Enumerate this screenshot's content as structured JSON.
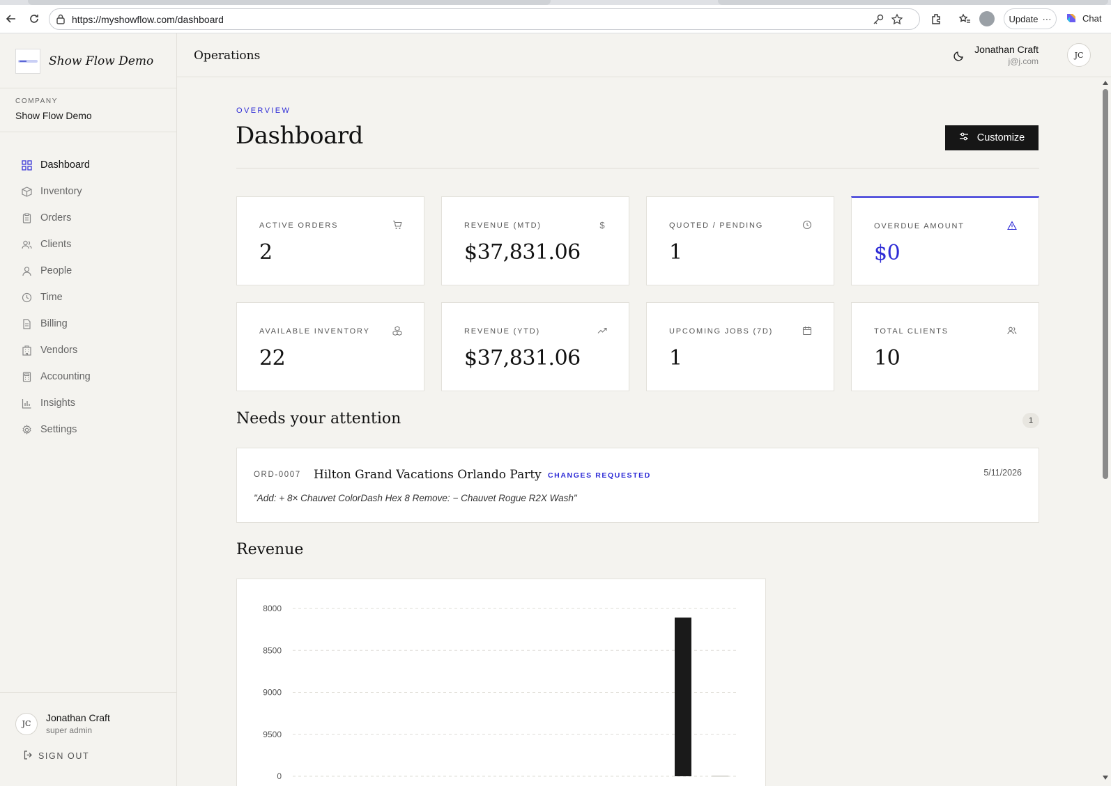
{
  "browser": {
    "url": "https://myshowflow.com/dashboard",
    "update_label": "Update",
    "chat_label": "Chat"
  },
  "sidebar": {
    "brand_name": "Show Flow Demo",
    "company_label": "COMPANY",
    "company_name": "Show Flow Demo",
    "items": [
      {
        "label": "Dashboard",
        "icon": "grid-icon",
        "active": true
      },
      {
        "label": "Inventory",
        "icon": "box-icon"
      },
      {
        "label": "Orders",
        "icon": "clipboard-icon"
      },
      {
        "label": "Clients",
        "icon": "users-icon"
      },
      {
        "label": "People",
        "icon": "user-icon"
      },
      {
        "label": "Time",
        "icon": "clock-icon"
      },
      {
        "label": "Billing",
        "icon": "file-icon"
      },
      {
        "label": "Vendors",
        "icon": "building-icon"
      },
      {
        "label": "Accounting",
        "icon": "calculator-icon"
      },
      {
        "label": "Insights",
        "icon": "bar-chart-icon"
      },
      {
        "label": "Settings",
        "icon": "gear-icon"
      }
    ],
    "user": {
      "initials": "JC",
      "name": "Jonathan Craft",
      "role": "super admin"
    },
    "signout_label": "SIGN OUT"
  },
  "header": {
    "title": "Operations",
    "user_name": "Jonathan Craft",
    "user_email": "j@j.com",
    "user_initials": "JC"
  },
  "main": {
    "overview_label": "OVERVIEW",
    "title": "Dashboard",
    "customize_label": "Customize",
    "stats": [
      {
        "label": "ACTIVE ORDERS",
        "value": "2",
        "icon": "cart-icon"
      },
      {
        "label": "REVENUE (MTD)",
        "value": "$37,831.06",
        "icon": "dollar-icon"
      },
      {
        "label": "QUOTED / PENDING",
        "value": "1",
        "icon": "clock-icon"
      },
      {
        "label": "OVERDUE AMOUNT",
        "value": "$0",
        "icon": "warning-icon"
      },
      {
        "label": "AVAILABLE INVENTORY",
        "value": "22",
        "icon": "boxes-icon"
      },
      {
        "label": "REVENUE (YTD)",
        "value": "$37,831.06",
        "icon": "trend-up-icon"
      },
      {
        "label": "UPCOMING JOBS (7D)",
        "value": "1",
        "icon": "calendar-icon"
      },
      {
        "label": "TOTAL CLIENTS",
        "value": "10",
        "icon": "users-icon"
      }
    ],
    "attention": {
      "title": "Needs your attention",
      "count": "1",
      "items": [
        {
          "order_id": "ORD-0007",
          "name": "Hilton Grand Vacations Orlando Party",
          "status": "CHANGES REQUESTED",
          "date": "5/11/2026",
          "note": "\"Add: + 8× Chauvet ColorDash Hex 8 Remove: − Chauvet Rogue R2X Wash\""
        }
      ]
    },
    "revenue_title": "Revenue"
  },
  "chart_data": {
    "type": "bar",
    "title": "",
    "y_tick_labels": [
      "8000",
      "8500",
      "9000",
      "9500",
      "0"
    ],
    "categories": [
      "",
      "",
      "",
      "",
      "",
      "",
      "",
      "",
      "",
      "",
      "",
      ""
    ],
    "values": [
      0,
      0,
      0,
      0,
      0,
      0,
      0,
      0,
      0,
      0,
      37831.06,
      150
    ],
    "ylim": [
      0,
      40000
    ],
    "grid": true,
    "bar_color": "#1a1a1a"
  },
  "colors": {
    "accent": "#2d2bd6",
    "background": "#f4f3ef",
    "card": "#ffffff",
    "dark_button": "#161616"
  }
}
